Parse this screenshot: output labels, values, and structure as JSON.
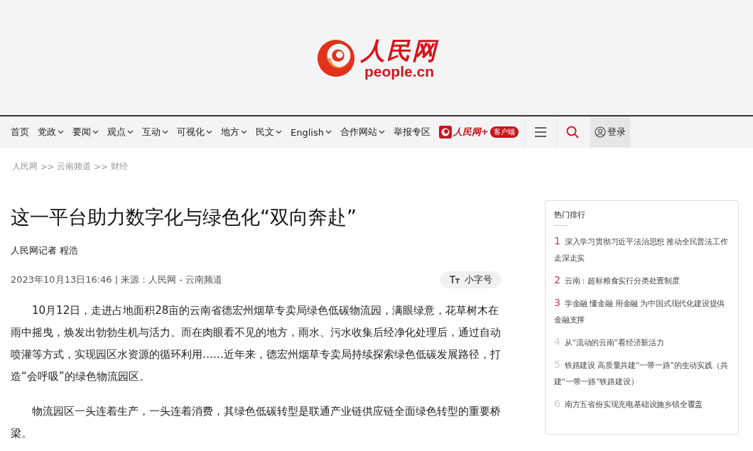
{
  "logo": {
    "name": "人民网",
    "domain": "people.cn"
  },
  "nav": {
    "items": [
      {
        "label": "首页",
        "dropdown": false
      },
      {
        "label": "党政",
        "dropdown": true
      },
      {
        "label": "要闻",
        "dropdown": true
      },
      {
        "label": "观点",
        "dropdown": true
      },
      {
        "label": "互动",
        "dropdown": true
      },
      {
        "label": "可视化",
        "dropdown": true
      },
      {
        "label": "地方",
        "dropdown": true
      },
      {
        "label": "民文",
        "dropdown": true
      },
      {
        "label": "English",
        "dropdown": true
      },
      {
        "label": "合作网站",
        "dropdown": true
      },
      {
        "label": "举报专区",
        "dropdown": false
      }
    ],
    "app": {
      "name": "人民网+",
      "badge": "客户端"
    },
    "login": "登录"
  },
  "breadcrumb": [
    {
      "label": "人民网"
    },
    {
      "label": "云南频道"
    },
    {
      "label": "财经"
    }
  ],
  "breadcrumb_separator": ">>",
  "article": {
    "title": "这一平台助力数字化与绿色化“双向奔赴”",
    "author": "人民网记者 程浩",
    "meta": "2023年10月13日16:46 | 来源：人民网 - 云南频道",
    "font_button": "小字号",
    "paragraphs": [
      "10月12日，走进占地面积28亩的云南省德宏州烟草专卖局绿色低碳物流园，满眼绿意，花草树木在雨中摇曳，焕发出勃勃生机与活力。而在肉眼看不见的地方，雨水、污水收集后经净化处理后，通过自动喷灌等方式，实现园区水资源的循环利用……近年来，德宏州烟草专卖局持续探索绿色低碳发展路径，打造“会呼吸”的绿色物流园区。",
      "物流园区一头连着生产，一头连着消费，其绿色低碳转型是联通产业链供应链全面绿色转型的重要桥梁。"
    ]
  },
  "hot_list": {
    "title": "热门排行",
    "items": [
      {
        "rank": "1",
        "text": "深入学习贯彻习近平法治思想 推动全民普法工作走深走实",
        "color": "#d23a4e"
      },
      {
        "rank": "2",
        "text": "云南：超标粮食实行分类处置制度",
        "color": "#d23a4e"
      },
      {
        "rank": "3",
        "text": "学金融 懂金融 用金融 为中国式现代化建设提供金融支撑",
        "color": "#d23a4e"
      },
      {
        "rank": "4",
        "text": "从“流动的云南”看经济新活力",
        "color": "#cccccc"
      },
      {
        "rank": "5",
        "text": "铁路建设 高质量共建“一带一路”的生动实践（共建“一带一路”铁路建设）",
        "color": "#cccccc"
      },
      {
        "rank": "6",
        "text": "南方五省份实现充电基础设施乡镇全覆盖",
        "color": "#cccccc"
      }
    ]
  }
}
